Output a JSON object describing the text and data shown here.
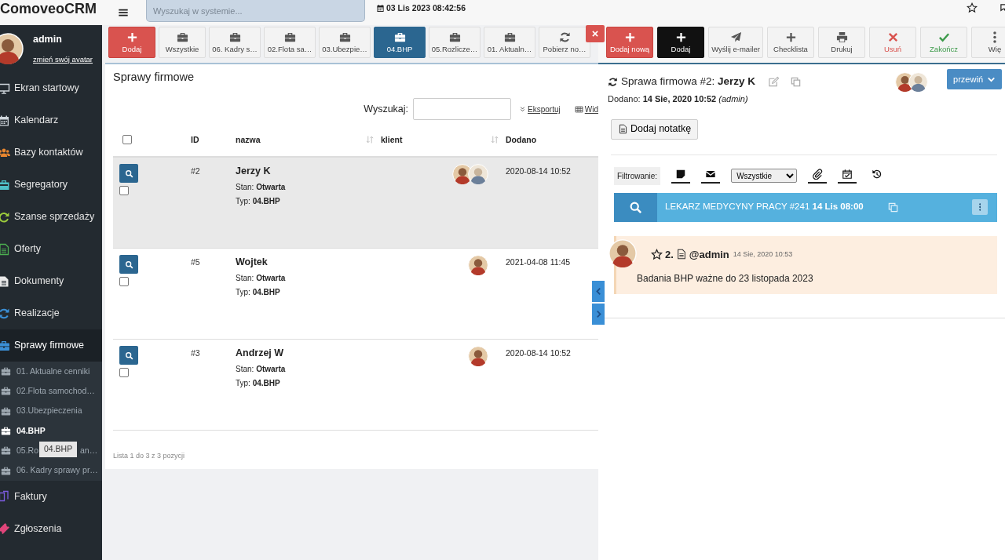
{
  "app": {
    "logo": "ComoveoCRM",
    "search_placeholder": "Wyszukaj w systemie...",
    "datetime": "03 Lis 2023 08:42:56"
  },
  "user": {
    "name": "admin",
    "link": "zmień swój avatar",
    "avatar": {
      "kind": "doll"
    }
  },
  "sidebar": {
    "items": [
      {
        "label": "Ekran startowy",
        "kind": "monitor",
        "selected": false
      },
      {
        "label": "Kalendarz",
        "kind": "calendar",
        "selected": false
      },
      {
        "label": "Bazy kontaktów",
        "kind": "users",
        "selected": false
      },
      {
        "label": "Segregatory",
        "kind": "binder",
        "selected": false
      },
      {
        "label": "Szanse sprzedaży",
        "kind": "sync",
        "selected": false
      },
      {
        "label": "Oferty",
        "kind": "offer",
        "selected": false
      },
      {
        "label": "Dokumenty",
        "kind": "document",
        "selected": false
      },
      {
        "label": "Realizacje",
        "kind": "refresh",
        "selected": false
      },
      {
        "label": "Sprawy firmowe",
        "kind": "briefcase",
        "selected": true,
        "children": [
          {
            "label": "01. Aktualne cenniki",
            "selected": false
          },
          {
            "label": "02.Flota samochod…",
            "selected": false
          },
          {
            "label": "03.Ubezpieczenia",
            "selected": false
          },
          {
            "label": "04.BHP",
            "selected": true
          },
          {
            "label": "05.Ro",
            "tail": "an…",
            "selected": false
          },
          {
            "label": "06. Kadry sprawy pr…",
            "selected": false
          }
        ]
      },
      {
        "label": "Faktury",
        "kind": "invoice",
        "selected": false
      },
      {
        "label": "Zgłoszenia",
        "kind": "ticket",
        "selected": false
      }
    ]
  },
  "tooltip": "04.BHP",
  "list_toolbar": {
    "buttons": [
      {
        "label": "Dodaj",
        "kind": "add",
        "selected": false
      },
      {
        "label": "Wszystkie",
        "kind": "folder",
        "selected": false
      },
      {
        "label": "06. Kadry s…",
        "kind": "folder",
        "selected": false
      },
      {
        "label": "02.Flota sa…",
        "kind": "folder",
        "selected": false
      },
      {
        "label": "03.Ubezpie…",
        "kind": "folder",
        "selected": false
      },
      {
        "label": "04.BHP",
        "kind": "folder",
        "selected": true
      },
      {
        "label": "05.Rozlicze…",
        "kind": "folder",
        "selected": false
      },
      {
        "label": "01. Aktualn…",
        "kind": "folder",
        "selected": false
      },
      {
        "label": "Pobierz no…",
        "kind": "refresh",
        "selected": false
      }
    ]
  },
  "detail_toolbar": {
    "buttons": [
      {
        "label": "Dodaj nową",
        "kind": "add"
      },
      {
        "label": "Dodaj",
        "kind": "add"
      },
      {
        "label": "Wyślij e-mailer",
        "kind": "send"
      },
      {
        "label": "Checklista",
        "kind": "add"
      },
      {
        "label": "Drukuj",
        "kind": "print"
      },
      {
        "label": "Usuń",
        "kind": "remove"
      },
      {
        "label": "Zakończ",
        "kind": "finish"
      },
      {
        "label": "Wię",
        "kind": "more"
      }
    ]
  },
  "list": {
    "title": "Sprawy firmowe",
    "search_label": "Wyszukaj:",
    "export": "Eksportuj",
    "view": "Wid",
    "select_all": false,
    "columns": [
      {
        "label": "ID",
        "sortable": false
      },
      {
        "label": "nazwa",
        "sortable": true
      },
      {
        "label": "klient",
        "sortable": true
      },
      {
        "label": "Dodano",
        "sortable": false
      }
    ],
    "rows": [
      {
        "id": "#2",
        "name": "Jerzy K",
        "state": "Stan: **Otwarta**",
        "type": "Typ: **04.BHP**",
        "clients": [
          {
            "kind": "doll"
          },
          {
            "kind": "photo"
          }
        ],
        "added": "2020-08-14 10:52",
        "selected": true,
        "checked": false
      },
      {
        "id": "#5",
        "name": "Wojtek",
        "state": "Stan: **Otwarta**",
        "type": "Typ: **04.BHP**",
        "clients": [
          {
            "kind": "doll"
          }
        ],
        "added": "2021-04-08 11:45",
        "selected": false,
        "checked": false
      },
      {
        "id": "#3",
        "name": "Andrzej W",
        "state": "Stan: **Otwarta**",
        "type": "Typ: **04.BHP**",
        "clients": [
          {
            "kind": "doll"
          }
        ],
        "added": "2020-08-14 10:52",
        "selected": false,
        "checked": false
      }
    ],
    "footer": "Lista 1 do 3 z 3 pozycji"
  },
  "detail": {
    "title": "Sprawa firmowa #2: **Jerzy K**",
    "people": [
      {
        "kind": "doll"
      },
      {
        "kind": "photo"
      }
    ],
    "scroll_button": "przewiń",
    "added": "Dodano: **14 Sie, 2020 10:52** *(admin)*",
    "add_note": "Dodaj notatkę",
    "filter_label": "Filtrowanie:",
    "filters": [
      {
        "kind": "notes",
        "active": true
      },
      {
        "kind": "mail",
        "active": true
      },
      {
        "kind": "select",
        "value": "Wszystkie"
      },
      {
        "kind": "attachments",
        "active": true
      },
      {
        "kind": "events",
        "active": true
      },
      {
        "kind": "history",
        "active": false
      }
    ],
    "event": {
      "text": "LEKARZ MEDYCYNY PRACY #241 **14 Lis 08:00**"
    },
    "notes": [
      {
        "number": "2.",
        "author": "@admin",
        "time": "14 Sie, 2020 10:53",
        "text": "Badania BHP ważne do 23 listopada 2023",
        "starred": false,
        "avatar": {
          "kind": "doll"
        }
      }
    ]
  }
}
